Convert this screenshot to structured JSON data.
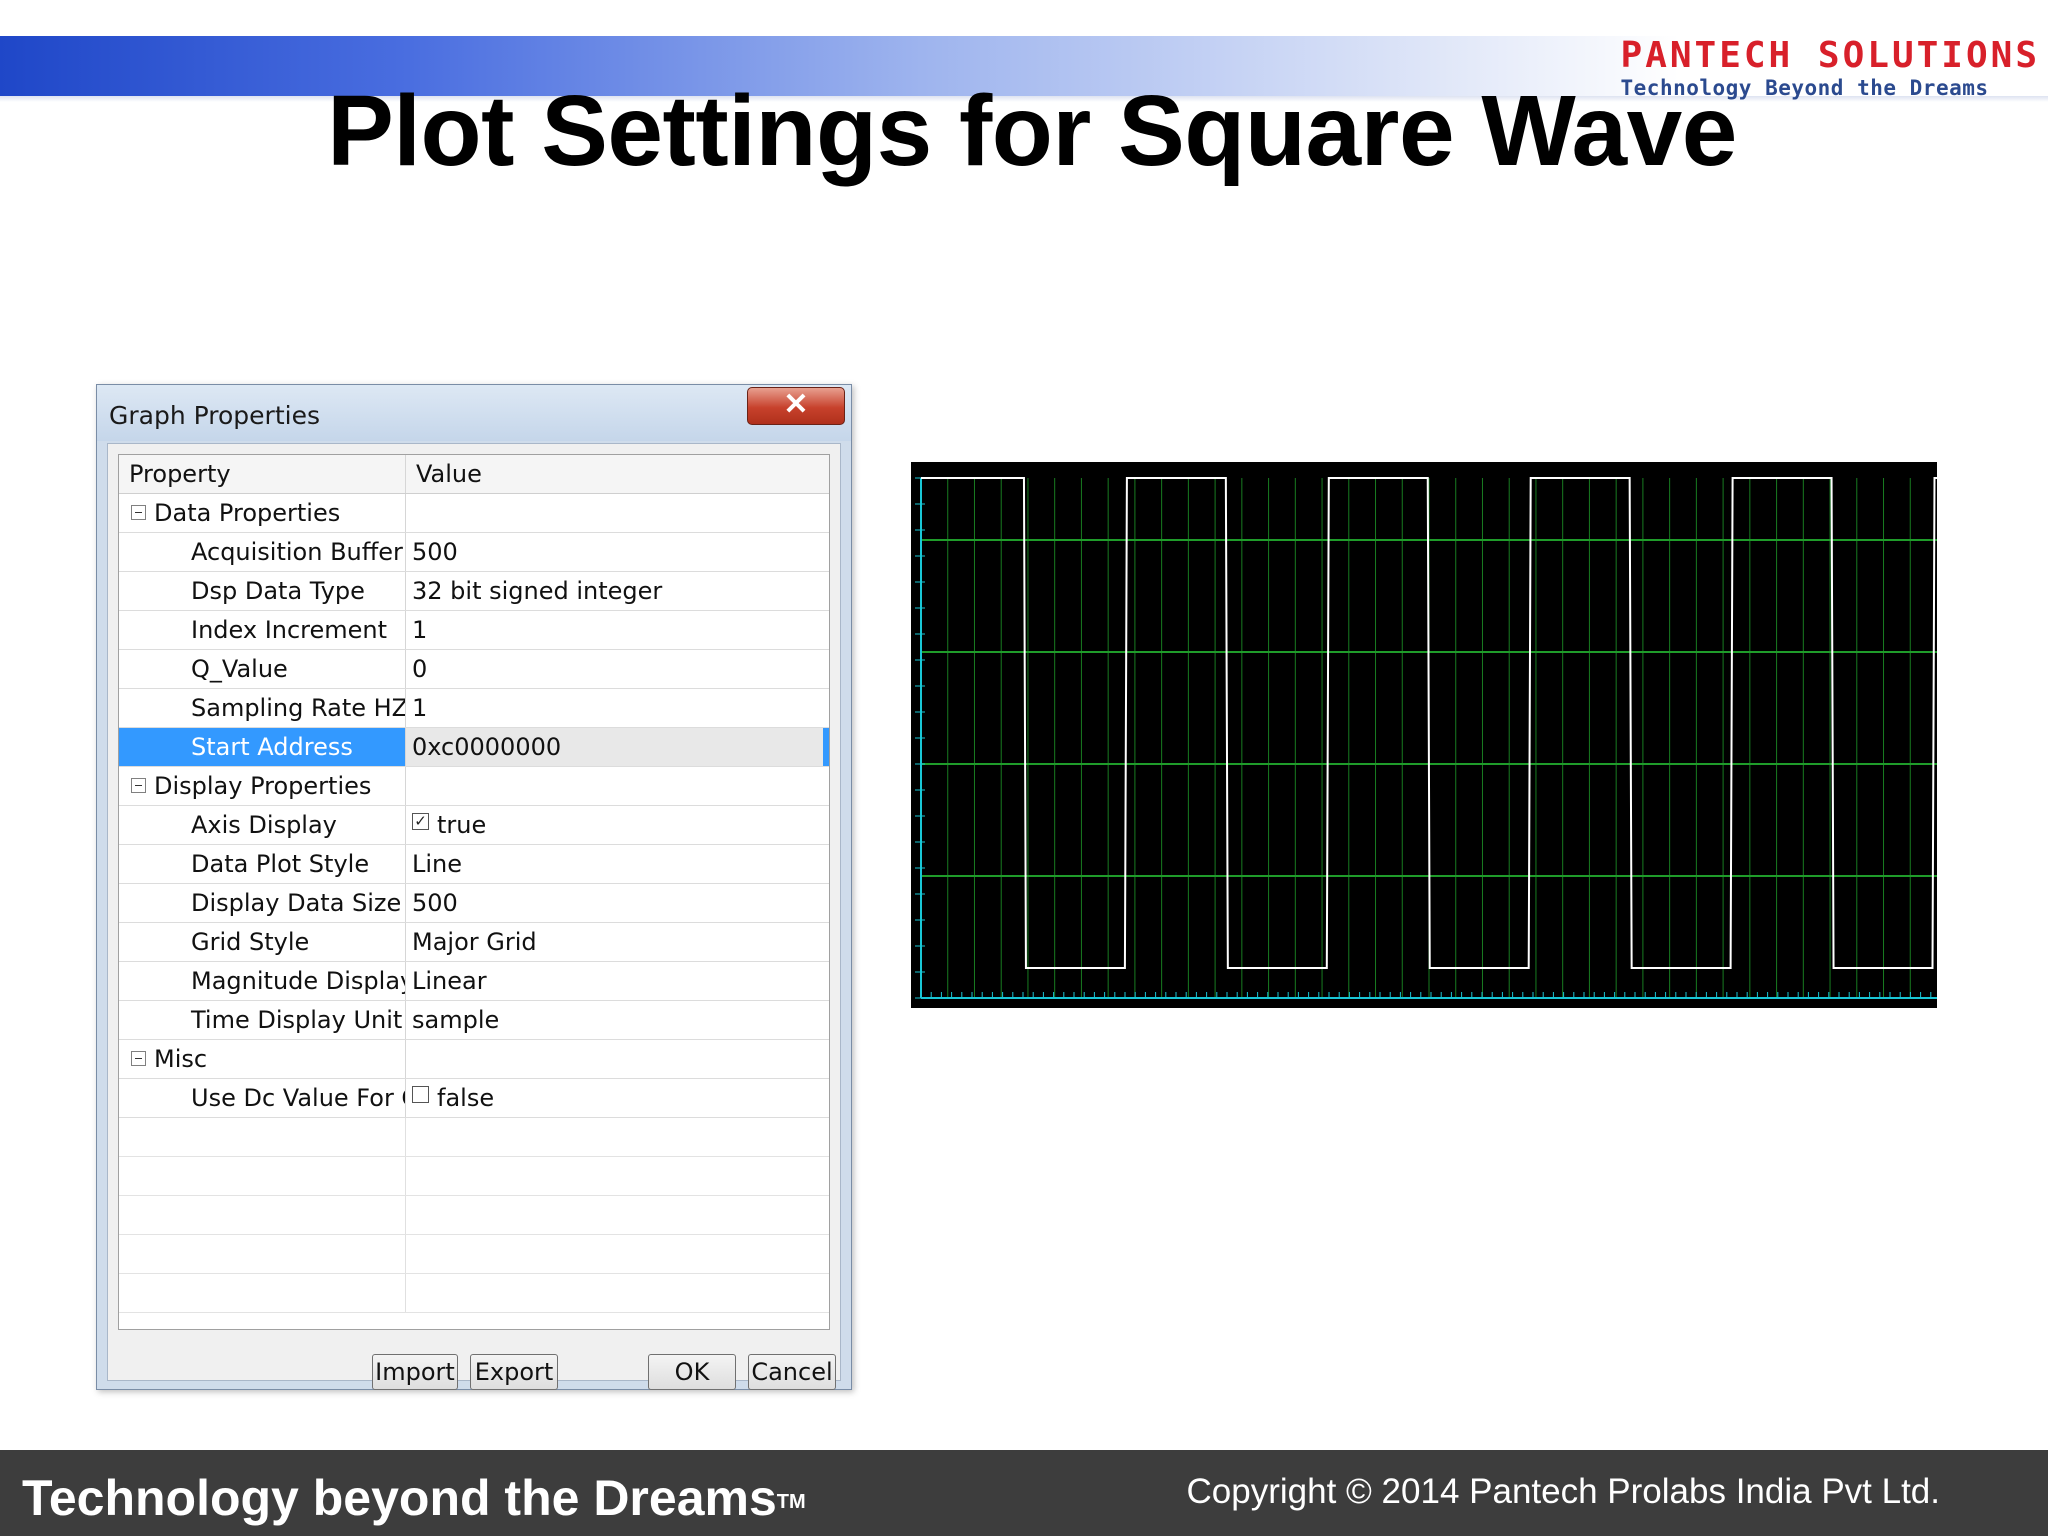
{
  "header": {
    "logo_name_left": "PANTECH",
    "logo_name_right": "SOLUTIONS",
    "logo_tagline": "Technology Beyond the Dreams",
    "slide_title": "Plot Settings for Square Wave"
  },
  "dialog": {
    "title": "Graph Properties",
    "close_glyph": "✕",
    "columns": {
      "property": "Property",
      "value": "Value"
    },
    "rows": [
      {
        "kind": "category",
        "label": "Data Properties"
      },
      {
        "kind": "prop",
        "label": "Acquisition Buffer S",
        "value": "500"
      },
      {
        "kind": "prop",
        "label": "Dsp Data Type",
        "value": "32 bit signed integer"
      },
      {
        "kind": "prop",
        "label": "Index Increment",
        "value": "1"
      },
      {
        "kind": "prop",
        "label": "Q_Value",
        "value": "0"
      },
      {
        "kind": "prop",
        "label": "Sampling Rate HZ",
        "value": "1"
      },
      {
        "kind": "prop",
        "label": "Start Address",
        "value": "0xc0000000",
        "selected": true
      },
      {
        "kind": "category",
        "label": "Display Properties"
      },
      {
        "kind": "prop",
        "label": "Axis Display",
        "value": "true",
        "checkbox": true,
        "checked": true
      },
      {
        "kind": "prop",
        "label": "Data Plot Style",
        "value": "Line"
      },
      {
        "kind": "prop",
        "label": "Display Data Size",
        "value": "500"
      },
      {
        "kind": "prop",
        "label": "Grid Style",
        "value": "Major Grid"
      },
      {
        "kind": "prop",
        "label": "Magnitude Display",
        "value": "Linear"
      },
      {
        "kind": "prop",
        "label": "Time Display Unit",
        "value": "sample"
      },
      {
        "kind": "category",
        "label": "Misc"
      },
      {
        "kind": "prop",
        "label": "Use Dc Value For Gi",
        "value": "false",
        "checkbox": true,
        "checked": false
      }
    ],
    "buttons": {
      "import": "Import",
      "export": "Export",
      "ok": "OK",
      "cancel": "Cancel"
    }
  },
  "scope": {
    "background": "#000000",
    "trace_color": "#ffffff",
    "grid_color": "#1f9c2a",
    "axis_color": "#19c7d6",
    "high_level": 1,
    "low_level": 0,
    "transitions_count": 10,
    "cycles_visible": 5
  },
  "footer": {
    "slogan": "Technology beyond the Dreams",
    "trademark": "TM",
    "copyright": "Copyright © 2014 Pantech Prolabs India Pvt Ltd."
  },
  "colors": {
    "brand_red": "#d8202a",
    "brand_blue": "#2b4a8f",
    "selection_blue": "#3399ff",
    "footer_bg": "#3d3d3d"
  }
}
